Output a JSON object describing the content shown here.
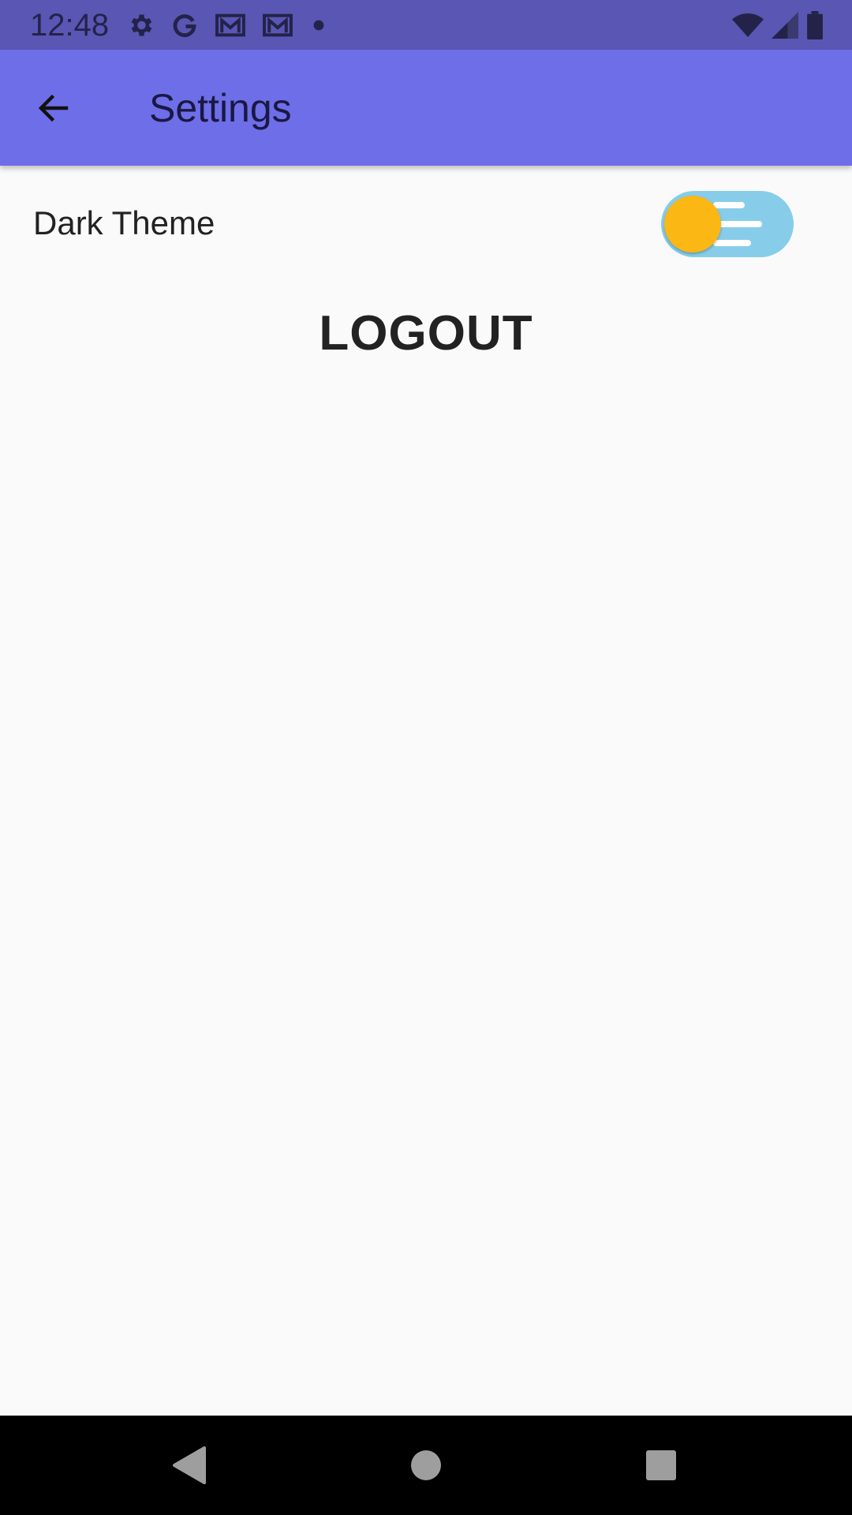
{
  "status_bar": {
    "time": "12:48",
    "left_icons": [
      "gear-icon",
      "google-g-icon",
      "gmail-icon",
      "gmail-icon",
      "dot-icon"
    ],
    "right_icons": [
      "wifi-icon",
      "cell-signal-icon",
      "battery-icon"
    ]
  },
  "app_bar": {
    "title": "Settings",
    "back_icon": "arrow-back-icon"
  },
  "settings": {
    "dark_theme_label": "Dark Theme",
    "dark_theme_enabled": false,
    "logout_label": "LOGOUT"
  },
  "nav_bar": {
    "buttons": [
      "back-triangle-icon",
      "home-circle-icon",
      "recents-square-icon"
    ]
  },
  "colors": {
    "status_bar": "#5a56b3",
    "app_bar": "#6e6ee8",
    "background": "#fafafa",
    "toggle_track": "#87cdea",
    "toggle_knob": "#fbb714",
    "nav_bar": "#000000"
  }
}
